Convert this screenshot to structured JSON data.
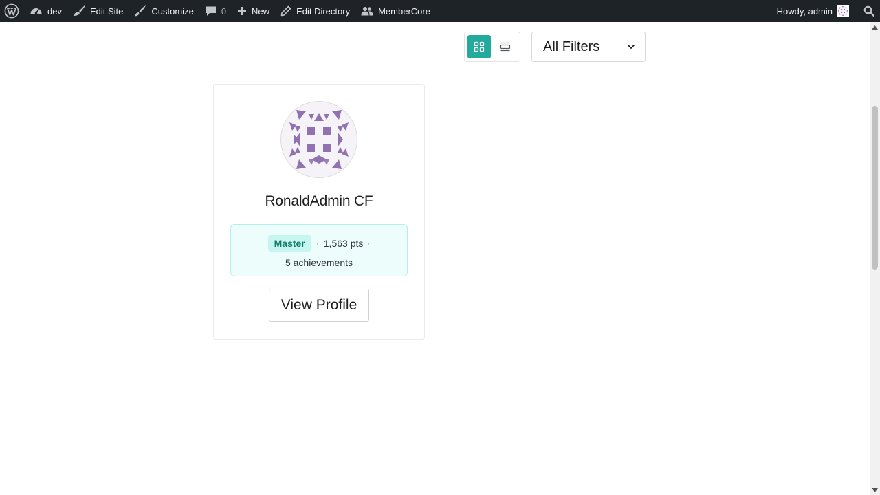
{
  "adminbar": {
    "site_name": "dev",
    "edit_site": "Edit Site",
    "customize": "Customize",
    "comments_count": "0",
    "new": "New",
    "edit_directory": "Edit Directory",
    "membercore": "MemberCore",
    "howdy": "Howdy, admin",
    "icons": [
      "wordpress-logo-icon",
      "dashboard-icon",
      "brush-icon",
      "paintbrush-icon",
      "comment-icon",
      "plus-icon",
      "pencil-icon",
      "users-icon",
      "search-icon"
    ]
  },
  "toolbar": {
    "active_view": "grid",
    "filters_label": "All Filters"
  },
  "member": {
    "name": "RonaldAdmin CF",
    "rank": "Master",
    "points": "1,563 pts",
    "achievements": "5 achievements",
    "view_profile_label": "View Profile"
  },
  "colors": {
    "adminbar_bg": "#1d2327",
    "accent": "#23aa9c",
    "avatar_fill": "#9172b0",
    "stats_bg": "#ecfdfc"
  }
}
